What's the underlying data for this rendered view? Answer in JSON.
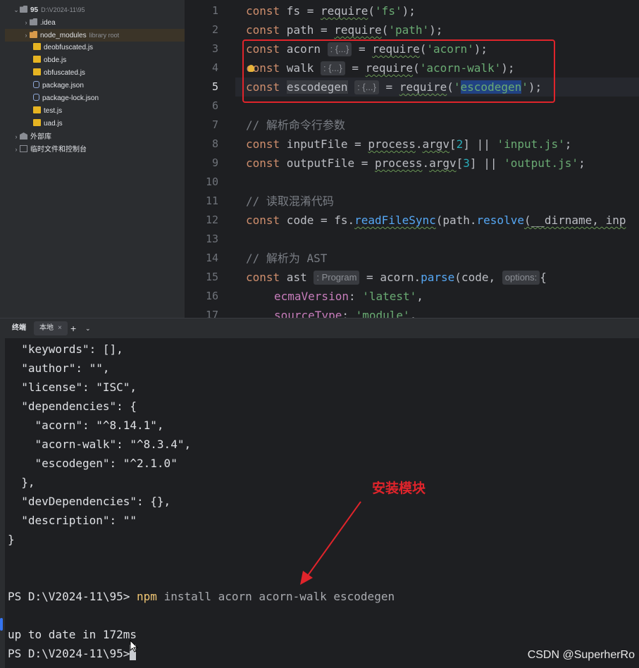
{
  "project_tree": {
    "root": {
      "name": "95",
      "path": "D:\\V2024-11\\95"
    },
    "items": [
      {
        "name": ".idea",
        "kind": "folder",
        "indent": 1
      },
      {
        "name": "node_modules",
        "note": "library root",
        "kind": "folder-lib",
        "indent": 1
      },
      {
        "name": "deobfuscated.js",
        "kind": "js",
        "indent": 2
      },
      {
        "name": "obde.js",
        "kind": "js",
        "indent": 2
      },
      {
        "name": "obfuscated.js",
        "kind": "js",
        "indent": 2
      },
      {
        "name": "package.json",
        "kind": "json",
        "indent": 2
      },
      {
        "name": "package-lock.json",
        "kind": "json",
        "indent": 2
      },
      {
        "name": "test.js",
        "kind": "js",
        "indent": 2
      },
      {
        "name": "uad.js",
        "kind": "js",
        "indent": 2
      }
    ],
    "external_libraries": "外部库",
    "scratches": "临时文件和控制台"
  },
  "editor": {
    "line_numbers": [
      "1",
      "2",
      "3",
      "4",
      "5",
      "6",
      "7",
      "8",
      "9",
      "10",
      "11",
      "12",
      "13",
      "14",
      "15",
      "16",
      "17"
    ],
    "current_line": "5",
    "hints": {
      "acorn": ": {...}",
      "walk": ": {...}",
      "escodegen": ": {...}",
      "ast": ": Program",
      "options": "options:"
    },
    "lines": {
      "l1_kw": "const",
      "l1_rest": " fs = ",
      "l1_fn": "require",
      "l1_open": "(",
      "l1_str": "'fs'",
      "l1_close": ");",
      "l2_kw": "const",
      "l2_rest": " path = ",
      "l2_fn": "require",
      "l2_open": "(",
      "l2_str": "'path'",
      "l2_close": ");",
      "l3_kw": "const",
      "l3_var": " acorn ",
      "l3_eq": " = ",
      "l3_fn": "require",
      "l3_open": "(",
      "l3_str": "'acorn'",
      "l3_close": ");",
      "l4_kw": "const",
      "l4_var": " walk ",
      "l4_eq": " = ",
      "l4_fn": "require",
      "l4_open": "(",
      "l4_str": "'acorn-walk'",
      "l4_close": ");",
      "l5_kw": "const",
      "l5_var1": " ",
      "l5_var2": "escodegen",
      "l5_eq": " = ",
      "l5_fn": "require",
      "l5_open": "(",
      "l5_q1": "'",
      "l5_sel": "escodegen",
      "l5_q2": "'",
      "l5_close": ");",
      "l7_cmt": "// 解析命令行参数",
      "l8_kw": "const",
      "l8_rest": " inputFile = ",
      "l8_obj": "process",
      "l8_dot": ".",
      "l8_prop": "argv",
      "l8_b1": "[",
      "l8_num": "2",
      "l8_b2": "] || ",
      "l8_str": "'input.js'",
      "l8_end": ";",
      "l9_kw": "const",
      "l9_rest": " outputFile = ",
      "l9_obj": "process",
      "l9_dot": ".",
      "l9_prop": "argv",
      "l9_b1": "[",
      "l9_num": "3",
      "l9_b2": "] || ",
      "l9_str": "'output.js'",
      "l9_end": ";",
      "l11_cmt": "// 读取混淆代码",
      "l12_kw": "const",
      "l12_rest": " code = fs.",
      "l12_fn": "readFileSync",
      "l12_p": "(path.",
      "l12_fn2": "resolve",
      "l12_tail": "(__dirname, inp",
      "l14_cmt": "// 解析为 AST",
      "l15_kw": "const",
      "l15_var": " ast ",
      "l15_eq": " = acorn.",
      "l15_fn": "parse",
      "l15_args": "(code, ",
      "l15_brace": "{",
      "l16_prop": "ecmaVersion",
      "l16_colon": ": ",
      "l16_str": "'latest'",
      "l16_end": ",",
      "l17_prop": "sourceType",
      "l17_colon": ": ",
      "l17_str": "'module'",
      "l17_end": ","
    }
  },
  "terminal": {
    "tab_title": "终端",
    "tab_local": "本地",
    "tab_close": "×",
    "new_tab": "+",
    "dropdown": "⌄",
    "output_lines": [
      "  \"keywords\": [],",
      "  \"author\": \"\",",
      "  \"license\": \"ISC\",",
      "  \"dependencies\": {",
      "    \"acorn\": \"^8.14.1\",",
      "    \"acorn-walk\": \"^8.3.4\",",
      "    \"escodegen\": \"^2.1.0\"",
      "  },",
      "  \"devDependencies\": {},",
      "  \"description\": \"\"",
      "}"
    ],
    "prompt": "PS D:\\V2024-11\\95> ",
    "command_exe": "npm",
    "command_args": " install acorn acorn-walk escodegen",
    "result": "up to date in 172ms",
    "prompt2": "PS D:\\V2024-11\\95>"
  },
  "annotation": {
    "text": "安装模块",
    "color": "#e0242b"
  },
  "watermark": "CSDN @SuperherRo"
}
